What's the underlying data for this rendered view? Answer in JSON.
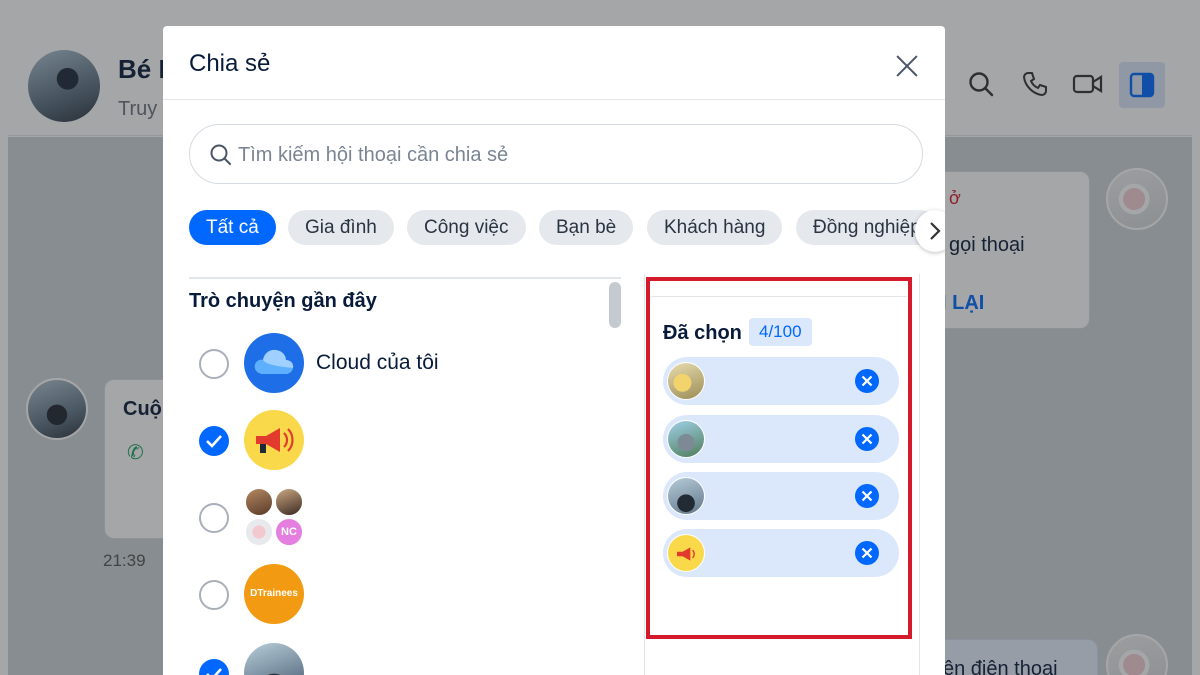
{
  "background": {
    "contact_name": "Bé D",
    "contact_status": "Truy",
    "card_top": {
      "text": "gọi thoại",
      "link": "I LẠI",
      "badge": "ở"
    },
    "card_left": {
      "title": "Cuộ"
    },
    "time": "21:39",
    "card_bottom": {
      "text": "ện điện thoại"
    }
  },
  "modal": {
    "title": "Chia sẻ",
    "search": {
      "placeholder": "Tìm kiếm hội thoại cần chia sẻ",
      "value": ""
    },
    "tabs": [
      {
        "label": "Tất cả",
        "active": true
      },
      {
        "label": "Gia đình",
        "active": false
      },
      {
        "label": "Công việc",
        "active": false
      },
      {
        "label": "Bạn bè",
        "active": false
      },
      {
        "label": "Khách hàng",
        "active": false
      },
      {
        "label": "Đồng nghiệp",
        "active": false
      }
    ],
    "recent": {
      "title": "Trò chuyện gần đây",
      "items": [
        {
          "name": "Cloud của tôi",
          "checked": false,
          "avatar": "cloud-icon"
        },
        {
          "name": "",
          "checked": true,
          "avatar": "megaphone-icon"
        },
        {
          "name": "",
          "checked": false,
          "avatar": "group-avatar",
          "badge": "NC"
        },
        {
          "name": "",
          "checked": false,
          "avatar": "dtrainees-logo",
          "logo_text": "DTrainees"
        },
        {
          "name": "",
          "checked": true,
          "avatar": "person-avatar"
        }
      ]
    },
    "selected": {
      "title": "Đã chọn",
      "count": "4/100",
      "items": [
        {
          "avatar": "yellow-flower-avatar"
        },
        {
          "avatar": "totoro-avatar"
        },
        {
          "avatar": "man-avatar"
        },
        {
          "avatar": "megaphone-icon"
        }
      ]
    }
  },
  "colors": {
    "accent": "#0068ff",
    "highlight_frame": "#d51a2b",
    "chip_bg": "#dbe7fb"
  }
}
